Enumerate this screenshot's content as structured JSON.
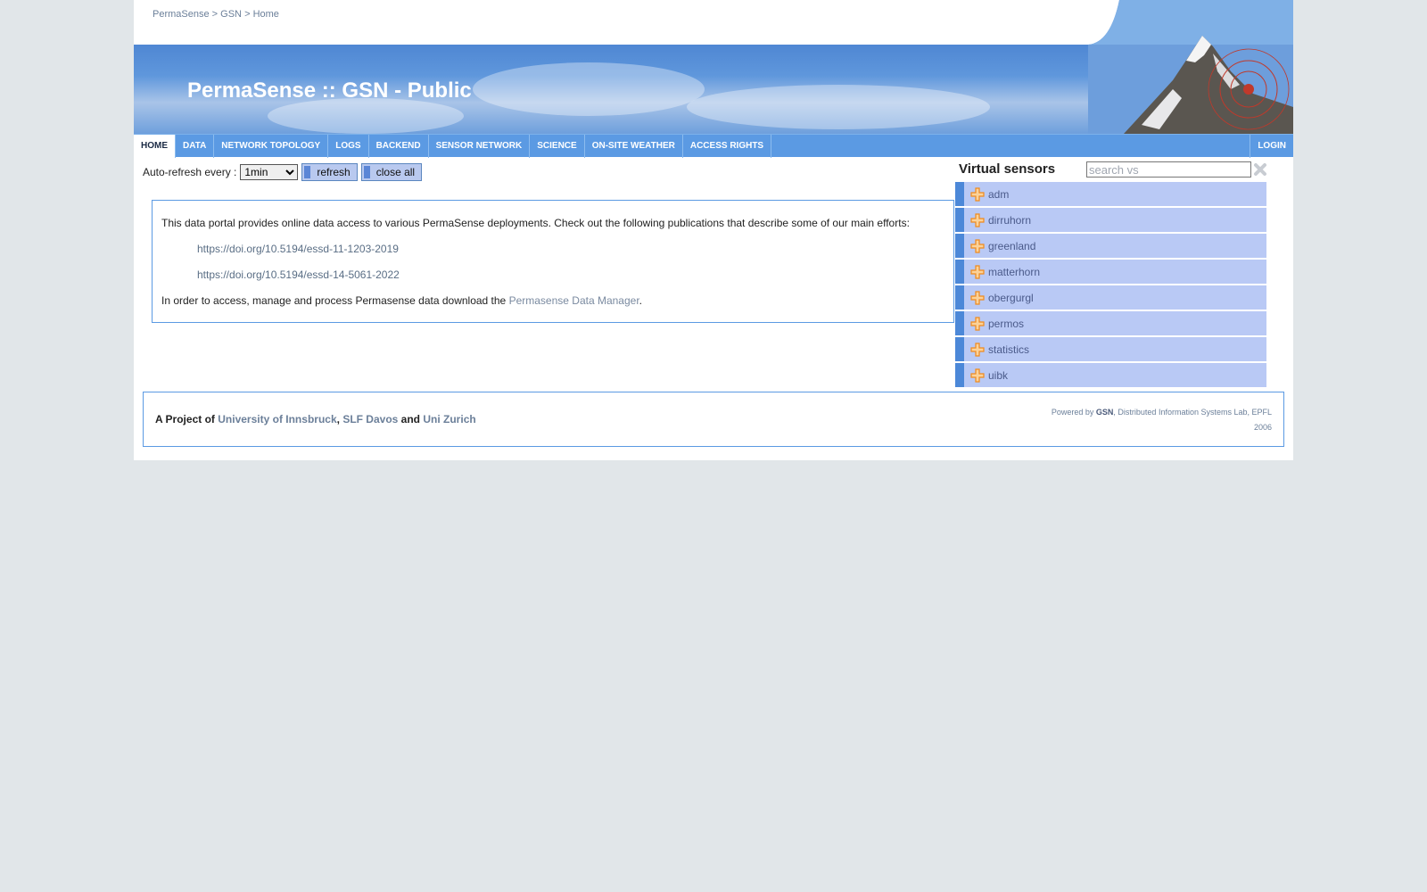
{
  "breadcrumb": {
    "item1": "PermaSense",
    "sep1": ">",
    "item2": "GSN",
    "sep2": ">",
    "item3": "Home"
  },
  "header": {
    "title": "PermaSense :: GSN - Public"
  },
  "nav": {
    "items": [
      "Home",
      "Data",
      "Network Topology",
      "Logs",
      "Backend",
      "Sensor Network",
      "Science",
      "On-site weather",
      "Access Rights"
    ],
    "login": "Login"
  },
  "controls": {
    "auto_refresh_label": "Auto-refresh every :",
    "refresh_value": "1min",
    "refresh_button": "refresh",
    "close_all_button": "close all"
  },
  "info": {
    "intro": "This data portal provides online data access to various PermaSense deployments. Check out the following publications that describe some of our main efforts:",
    "publications": [
      "https://doi.org/10.5194/essd-11-1203-2019",
      "https://doi.org/10.5194/essd-14-5061-2022"
    ],
    "access_text": "In order to access, manage and process Permasense data download the ",
    "access_link": "Permasense Data Manager",
    "access_end": "."
  },
  "sidebar": {
    "title": "Virtual sensors",
    "search_placeholder": "search vs",
    "items": [
      "adm",
      "dirruhorn",
      "greenland",
      "matterhorn",
      "obergurgl",
      "permos",
      "statistics",
      "uibk"
    ]
  },
  "footer": {
    "project_prefix": "A Project of",
    "org1": "University of Innsbruck",
    "comma": ",",
    "org2": "SLF Davos",
    "and": "and",
    "org3": "Uni Zurich",
    "powered_prefix": "Powered by",
    "powered_name": "GSN",
    "powered_suffix": ", Distributed Information Systems Lab, EPFL",
    "year": "2006"
  },
  "colors": {
    "nav_blue": "#5b9ae3",
    "background": "#e1e6e9",
    "vs_item": "#b9c9f5",
    "accent_orange": "#f08a1c"
  }
}
